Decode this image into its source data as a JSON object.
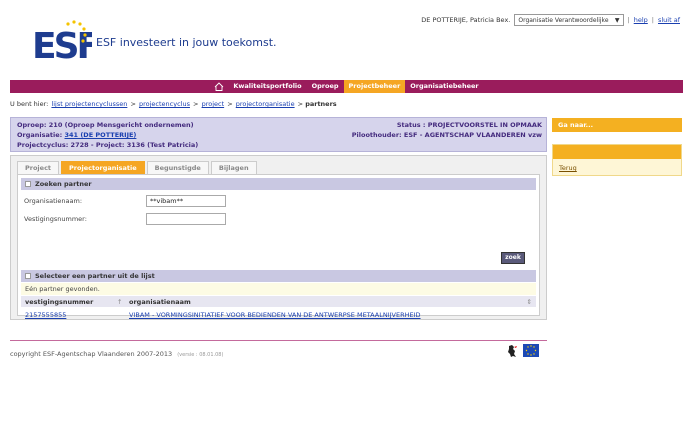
{
  "header": {
    "logo_text": "ESF investeert in jouw toekomst.",
    "user_name": "DE POTTERIJE,  Patricia Bex.",
    "role_select": "Organisatie Verantwoordelijke",
    "help": "help",
    "logout": "sluit af",
    "separator": "|"
  },
  "nav": {
    "items": [
      "Kwaliteitsportfolio",
      "Oproep",
      "Projectbeheer",
      "Organisatiebeheer"
    ],
    "active": "Projectbeheer",
    "accent": "#9a1c5c",
    "active_color": "#f5a623"
  },
  "breadcrumb": {
    "prefix": "U bent hier:",
    "links": [
      "lijst projectencyclussen",
      "projectencyclus",
      "project",
      "projectorganisatie"
    ],
    "separator": ">",
    "current": "partners"
  },
  "info": {
    "oproep": "Oproep: 210 (Oproep Mensgericht ondernemen)",
    "organisatie_label": "Organisatie:",
    "organisatie_link": "341 (DE POTTERIJE)",
    "projectcyclus": "Projectcyclus: 2728 - Project: 3136 (Test Patricia)",
    "status": "Status : PROJECTVOORSTEL IN OPMAAK",
    "piloothouder": "Piloothouder: ESF - AGENTSCHAP VLAANDEREN vzw"
  },
  "side": {
    "goto": "Ga naar...",
    "terug": "Terug"
  },
  "tabs": [
    "Project",
    "Projectorganisatie",
    "Begunstigde",
    "Bijlagen"
  ],
  "active_tab": "Projectorganisatie",
  "search": {
    "heading": "Zoeken partner",
    "org_label": "Organisatienaam:",
    "org_value": "**vibam**",
    "vest_label": "Vestigingsnummer:",
    "vest_value": "",
    "button": "zoek"
  },
  "results": {
    "heading": "Selecteer een partner uit de lijst",
    "found": "Eén partner gevonden.",
    "columns": [
      "vestigingsnummer",
      "organisatienaam"
    ],
    "sort_asc": "↑",
    "sort_both": "⇕",
    "rows": [
      {
        "vestigingsnummer": "2157555855",
        "organisatienaam": "VIBAM - VORMINGSINITIATIEF VOOR BEDIENDEN VAN DE ANTWERPSE METAALNIJVERHEID"
      }
    ]
  },
  "footer": {
    "copyright": "copyright ESF-Agentschap Vlaanderen 2007-2013",
    "version": "(versie : 08.01.08)"
  }
}
